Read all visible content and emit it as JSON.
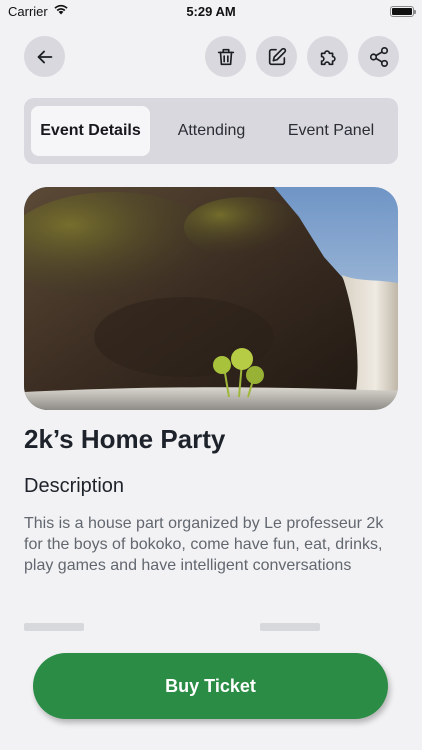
{
  "status_bar": {
    "carrier": "Carrier",
    "time": "5:29 AM"
  },
  "header": {
    "back_icon": "arrow-left-icon",
    "actions": [
      "trash-icon",
      "edit-icon",
      "puzzle-icon",
      "share-icon"
    ]
  },
  "tabs": [
    {
      "label": "Event Details",
      "active": true
    },
    {
      "label": "Attending",
      "active": false
    },
    {
      "label": "Event Panel",
      "active": false
    }
  ],
  "event": {
    "title": "2k’s Home Party",
    "description_heading": "Description",
    "description": "This is a house part organized by Le professeur 2k for the boys of bokoko, come have fun, eat, drinks, play games and have intelligent conversations"
  },
  "buy_button": {
    "label": "Buy Ticket"
  },
  "colors": {
    "accent": "#2b8d45",
    "background": "#f2f2f4",
    "button_bg": "#d9d8de"
  }
}
